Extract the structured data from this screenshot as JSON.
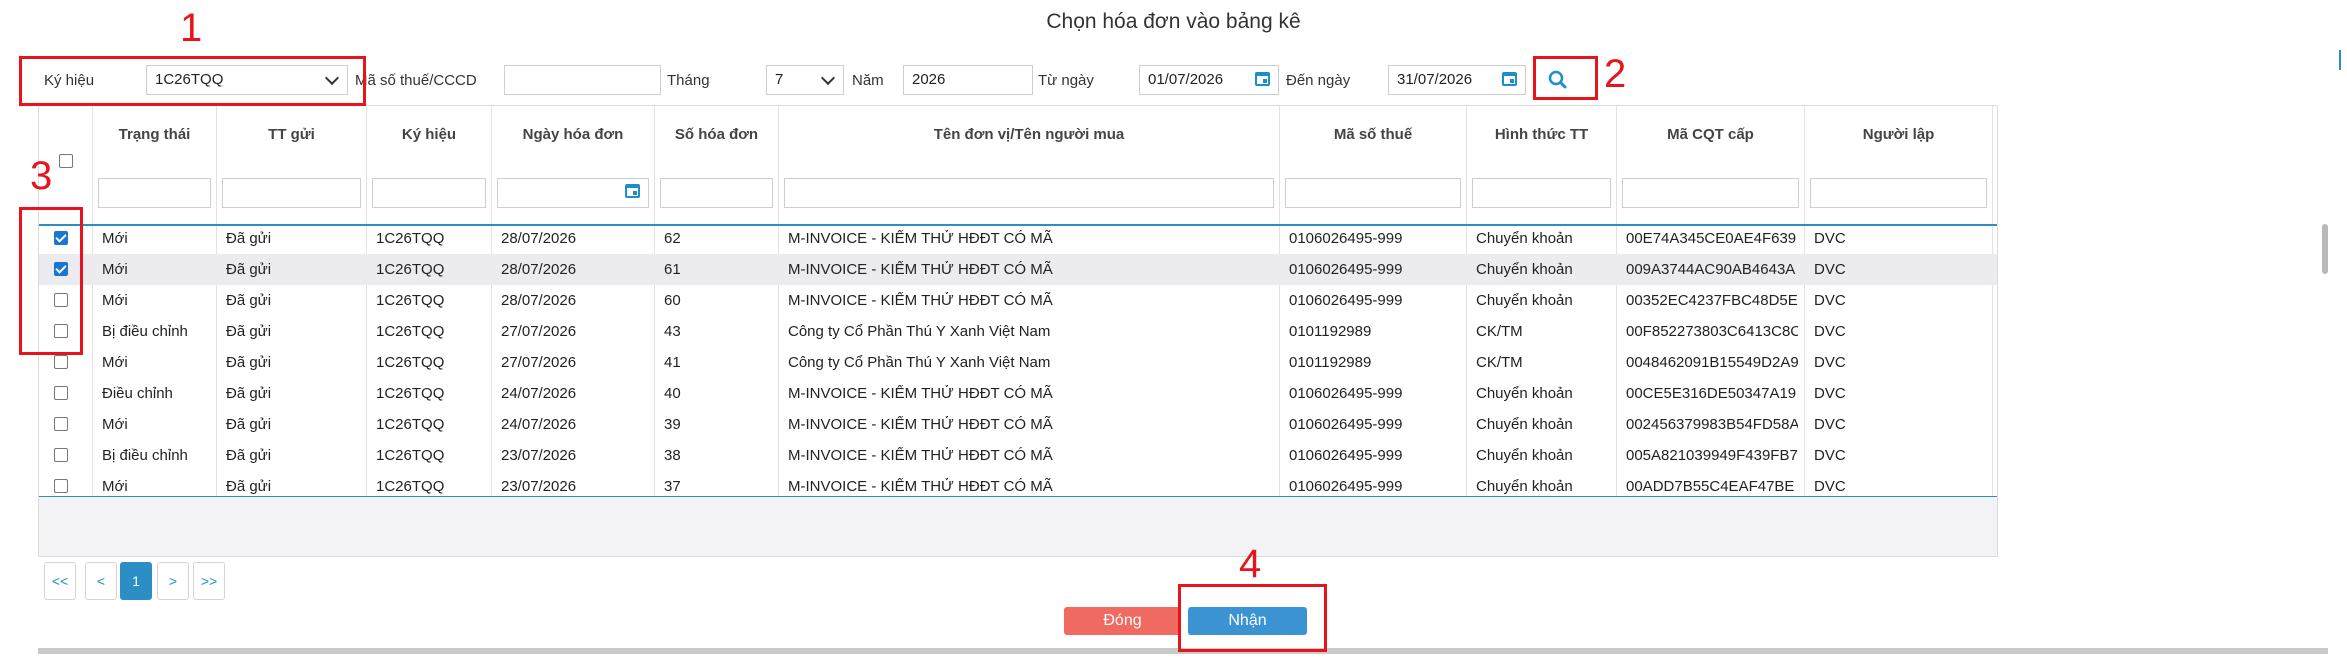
{
  "dialog": {
    "title": "Chọn hóa đơn vào bảng kê"
  },
  "filters": {
    "ky_hieu_label": "Ký hiệu",
    "ky_hieu_value": "1C26TQQ",
    "mst_label": "Mã số thuế/CCCD",
    "mst_value": "",
    "thang_label": "Tháng",
    "thang_value": "7",
    "nam_label": "Năm",
    "nam_value": "2026",
    "tu_ngay_label": "Từ ngày",
    "tu_ngay_value": "01/07/2026",
    "den_ngay_label": "Đến ngày",
    "den_ngay_value": "31/07/2026"
  },
  "annotations": [
    "1",
    "2",
    "3",
    "4"
  ],
  "table": {
    "columns": [
      "Trạng thái",
      "TT gửi",
      "Ký hiệu",
      "Ngày hóa đơn",
      "Số hóa đơn",
      "Tên đơn vị/Tên người mua",
      "Mã số thuế",
      "Hình thức TT",
      "Mã CQT cấp",
      "Người lập"
    ],
    "rows": [
      {
        "checked": true,
        "cells": [
          "Mới",
          "Đã gửi",
          "1C26TQQ",
          "28/07/2026",
          "62",
          "M-INVOICE - KIỂM THỬ HĐĐT CÓ MÃ",
          "0106026495-999",
          "Chuyển khoản",
          "00E74A345CE0AE4F639",
          "DVC"
        ]
      },
      {
        "checked": true,
        "cells": [
          "Mới",
          "Đã gửi",
          "1C26TQQ",
          "28/07/2026",
          "61",
          "M-INVOICE - KIỂM THỬ HĐĐT CÓ MÃ",
          "0106026495-999",
          "Chuyển khoản",
          "009A3744AC90AB4643A",
          "DVC"
        ]
      },
      {
        "checked": false,
        "cells": [
          "Mới",
          "Đã gửi",
          "1C26TQQ",
          "28/07/2026",
          "60",
          "M-INVOICE - KIỂM THỬ HĐĐT CÓ MÃ",
          "0106026495-999",
          "Chuyển khoản",
          "00352EC4237FBC48D5E",
          "DVC"
        ]
      },
      {
        "checked": false,
        "cells": [
          "Bị điều chỉnh",
          "Đã gửi",
          "1C26TQQ",
          "27/07/2026",
          "43",
          "Công ty Cổ Phần Thú Y Xanh Việt Nam",
          "0101192989",
          "CK/TM",
          "00F852273803C6413C8C",
          "DVC"
        ]
      },
      {
        "checked": false,
        "cells": [
          "Mới",
          "Đã gửi",
          "1C26TQQ",
          "27/07/2026",
          "41",
          "Công ty Cổ Phần Thú Y Xanh Việt Nam",
          "0101192989",
          "CK/TM",
          "0048462091B15549D2A9",
          "DVC"
        ]
      },
      {
        "checked": false,
        "cells": [
          "Điều chỉnh",
          "Đã gửi",
          "1C26TQQ",
          "24/07/2026",
          "40",
          "M-INVOICE - KIỂM THỬ HĐĐT CÓ MÃ",
          "0106026495-999",
          "Chuyển khoản",
          "00CE5E316DE50347A19",
          "DVC"
        ]
      },
      {
        "checked": false,
        "cells": [
          "Mới",
          "Đã gửi",
          "1C26TQQ",
          "24/07/2026",
          "39",
          "M-INVOICE - KIỂM THỬ HĐĐT CÓ MÃ",
          "0106026495-999",
          "Chuyển khoản",
          "002456379983B54FD58A",
          "DVC"
        ]
      },
      {
        "checked": false,
        "cells": [
          "Bị điều chỉnh",
          "Đã gửi",
          "1C26TQQ",
          "23/07/2026",
          "38",
          "M-INVOICE - KIỂM THỬ HĐĐT CÓ MÃ",
          "0106026495-999",
          "Chuyển khoản",
          "005A821039949F439FB7",
          "DVC"
        ]
      },
      {
        "checked": false,
        "cells": [
          "Mới",
          "Đã gửi",
          "1C26TQQ",
          "23/07/2026",
          "37",
          "M-INVOICE - KIỂM THỬ HĐĐT CÓ MÃ",
          "0106026495-999",
          "Chuyển khoản",
          "00ADD7B55C4EAF47BE",
          "DVC"
        ]
      }
    ]
  },
  "pagination": {
    "first": "<<",
    "prev": "<",
    "current": "1",
    "next": ">",
    "last": ">>"
  },
  "buttons": {
    "close": "Đóng",
    "accept": "Nhận"
  },
  "colors": {
    "accent": "#2b8fc6",
    "close_button": "#f06a62",
    "accept_button": "#3a94d3",
    "annotation": "#e8141b"
  }
}
